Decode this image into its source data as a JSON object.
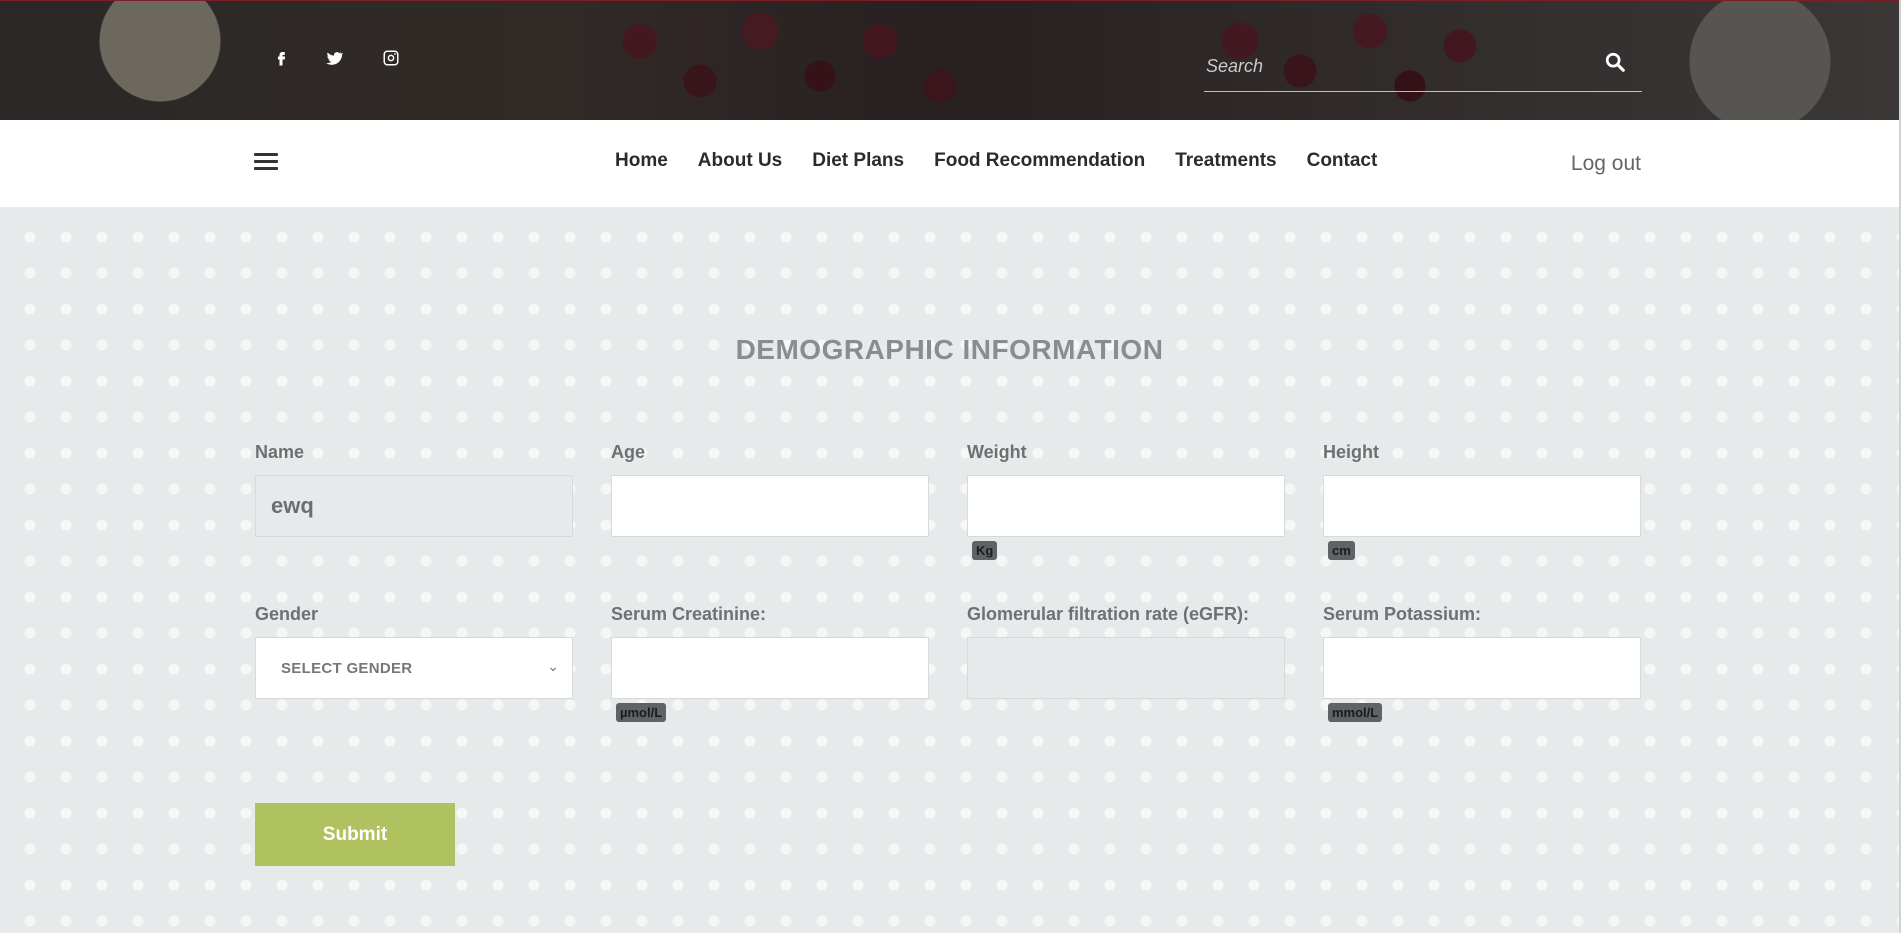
{
  "header": {
    "social": [
      {
        "name": "facebook-icon"
      },
      {
        "name": "twitter-icon"
      },
      {
        "name": "instagram-icon"
      }
    ],
    "search": {
      "placeholder": "Search",
      "value": ""
    }
  },
  "nav": {
    "items": [
      {
        "label": "Home"
      },
      {
        "label": "About Us"
      },
      {
        "label": "Diet Plans"
      },
      {
        "label": "Food Recommendation"
      },
      {
        "label": "Treatments"
      },
      {
        "label": "Contact"
      }
    ],
    "logout_label": "Log out"
  },
  "form": {
    "title": "DEMOGRAPHIC INFORMATION",
    "name": {
      "label": "Name",
      "value": "ewq"
    },
    "age": {
      "label": "Age",
      "value": ""
    },
    "weight": {
      "label": "Weight",
      "value": "",
      "unit": "Kg"
    },
    "height": {
      "label": "Height",
      "value": "",
      "unit": "cm"
    },
    "gender": {
      "label": "Gender",
      "selected": "SELECT GENDER"
    },
    "serum_creatinine": {
      "label": "Serum Creatinine:",
      "value": "",
      "unit": "µmol/L"
    },
    "egfr": {
      "label": "Glomerular filtration rate (eGFR):",
      "value": ""
    },
    "serum_potassium": {
      "label": "Serum Potassium:",
      "value": "",
      "unit": "mmol/L"
    },
    "submit_label": "Submit"
  },
  "colors": {
    "submit_bg": "#b0c260",
    "badge_bg": "#5f6368",
    "page_bg": "#e6eaea"
  }
}
